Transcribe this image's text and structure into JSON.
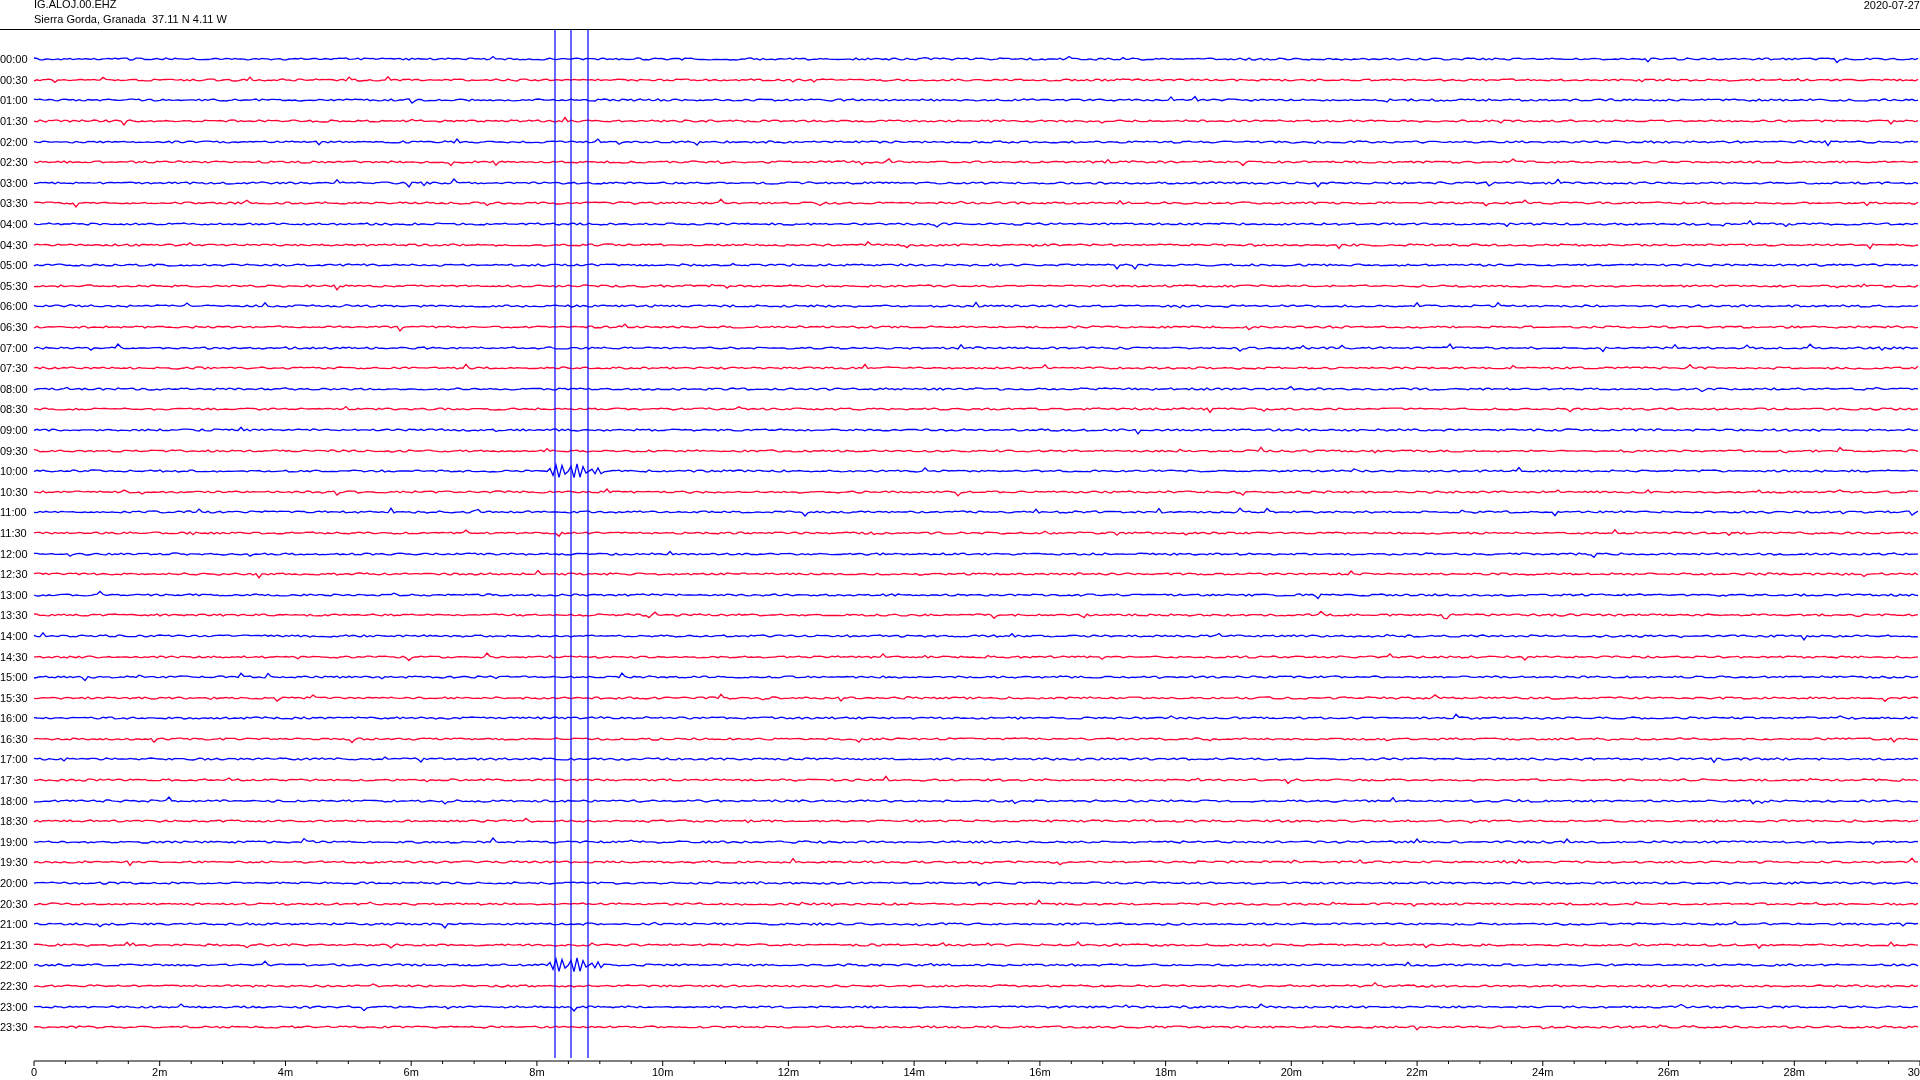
{
  "header": {
    "station": "IG.ALOJ.00.EHZ",
    "location": "Sierra Gorda, Granada  37.11 N 4.11 W",
    "date": "2020-07-27"
  },
  "traces": [
    {
      "time": "00:00",
      "color": "#0000ff",
      "event": false
    },
    {
      "time": "00:30",
      "color": "#ff0033",
      "event": false
    },
    {
      "time": "01:00",
      "color": "#0000ff",
      "event": false
    },
    {
      "time": "01:30",
      "color": "#ff0033",
      "event": false
    },
    {
      "time": "02:00",
      "color": "#0000ff",
      "event": false
    },
    {
      "time": "02:30",
      "color": "#ff0033",
      "event": false
    },
    {
      "time": "03:00",
      "color": "#0000ff",
      "event": false
    },
    {
      "time": "03:30",
      "color": "#ff0033",
      "event": false
    },
    {
      "time": "04:00",
      "color": "#0000ff",
      "event": false
    },
    {
      "time": "04:30",
      "color": "#ff0033",
      "event": false
    },
    {
      "time": "05:00",
      "color": "#0000ff",
      "event": false
    },
    {
      "time": "05:30",
      "color": "#ff0033",
      "event": false
    },
    {
      "time": "06:00",
      "color": "#0000ff",
      "event": false
    },
    {
      "time": "06:30",
      "color": "#ff0033",
      "event": false
    },
    {
      "time": "07:00",
      "color": "#0000ff",
      "event": false
    },
    {
      "time": "07:30",
      "color": "#ff0033",
      "event": false
    },
    {
      "time": "08:00",
      "color": "#0000ff",
      "event": false
    },
    {
      "time": "08:30",
      "color": "#ff0033",
      "event": false
    },
    {
      "time": "09:00",
      "color": "#0000ff",
      "event": false
    },
    {
      "time": "09:30",
      "color": "#ff0033",
      "event": false
    },
    {
      "time": "10:00",
      "color": "#0000ff",
      "event": true
    },
    {
      "time": "10:30",
      "color": "#ff0033",
      "event": false
    },
    {
      "time": "11:00",
      "color": "#0000ff",
      "event": false
    },
    {
      "time": "11:30",
      "color": "#ff0033",
      "event": false
    },
    {
      "time": "12:00",
      "color": "#0000ff",
      "event": false
    },
    {
      "time": "12:30",
      "color": "#ff0033",
      "event": false
    },
    {
      "time": "13:00",
      "color": "#0000ff",
      "event": false
    },
    {
      "time": "13:30",
      "color": "#ff0033",
      "event": false
    },
    {
      "time": "14:00",
      "color": "#0000ff",
      "event": false
    },
    {
      "time": "14:30",
      "color": "#ff0033",
      "event": false
    },
    {
      "time": "15:00",
      "color": "#0000ff",
      "event": false
    },
    {
      "time": "15:30",
      "color": "#ff0033",
      "event": false
    },
    {
      "time": "16:00",
      "color": "#0000ff",
      "event": false
    },
    {
      "time": "16:30",
      "color": "#ff0033",
      "event": false
    },
    {
      "time": "17:00",
      "color": "#0000ff",
      "event": false
    },
    {
      "time": "17:30",
      "color": "#ff0033",
      "event": false
    },
    {
      "time": "18:00",
      "color": "#0000ff",
      "event": false
    },
    {
      "time": "18:30",
      "color": "#ff0033",
      "event": false
    },
    {
      "time": "19:00",
      "color": "#0000ff",
      "event": false
    },
    {
      "time": "19:30",
      "color": "#ff0033",
      "event": false
    },
    {
      "time": "20:00",
      "color": "#0000ff",
      "event": false
    },
    {
      "time": "20:30",
      "color": "#ff0033",
      "event": false
    },
    {
      "time": "21:00",
      "color": "#0000ff",
      "event": false
    },
    {
      "time": "21:30",
      "color": "#ff0033",
      "event": false
    },
    {
      "time": "22:00",
      "color": "#0000ff",
      "event": true
    },
    {
      "time": "22:30",
      "color": "#ff0033",
      "event": false
    },
    {
      "time": "23:00",
      "color": "#0000ff",
      "event": false
    },
    {
      "time": "23:30",
      "color": "#ff0033",
      "event": false
    }
  ],
  "x_axis": {
    "labels": [
      "0",
      "2m",
      "4m",
      "6m",
      "8m",
      "10m",
      "12m",
      "14m",
      "16m",
      "18m",
      "20m",
      "22m",
      "24m",
      "26m",
      "28m",
      "30"
    ]
  }
}
